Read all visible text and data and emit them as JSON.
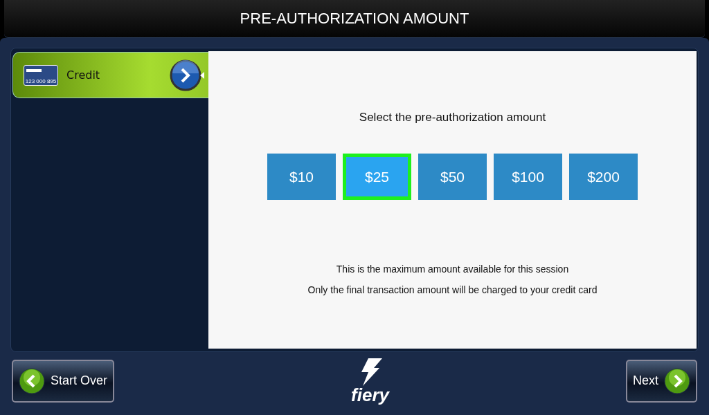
{
  "window": {
    "title": "PRE-AUTHORIZATION AMOUNT"
  },
  "sidebar": {
    "items": [
      {
        "label": "Credit",
        "card_number": "123 000 895",
        "selected": true
      }
    ]
  },
  "content": {
    "heading": "Select the pre-authorization amount",
    "amounts": [
      {
        "label": "$10",
        "selected": false
      },
      {
        "label": "$25",
        "selected": true
      },
      {
        "label": "$50",
        "selected": false
      },
      {
        "label": "$100",
        "selected": false
      },
      {
        "label": "$200",
        "selected": false
      }
    ],
    "notes": [
      "This is the maximum amount available for this session",
      "Only the final transaction amount will be charged to your credit card"
    ]
  },
  "footer": {
    "back_button": "Start Over",
    "logo": "fiery",
    "next_button": "Next"
  }
}
